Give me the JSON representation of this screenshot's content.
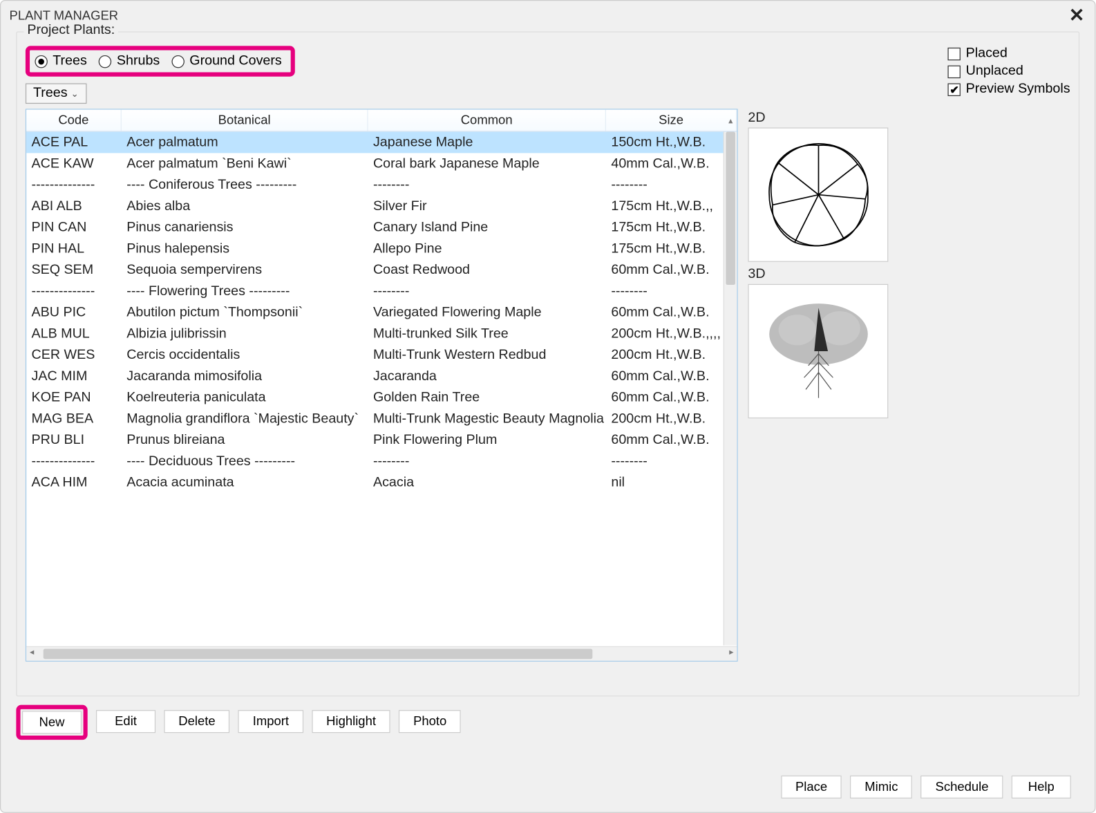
{
  "window": {
    "title": "PLANT MANAGER"
  },
  "group": {
    "label": "Project Plants:"
  },
  "radios": {
    "trees": "Trees",
    "shrubs": "Shrubs",
    "ground": "Ground Covers",
    "selected": "trees"
  },
  "checks": {
    "placed": {
      "label": "Placed",
      "checked": false
    },
    "unplaced": {
      "label": "Unplaced",
      "checked": false
    },
    "preview": {
      "label": "Preview Symbols",
      "checked": true
    }
  },
  "dropdown": {
    "value": "Trees"
  },
  "columns": {
    "code": "Code",
    "botanical": "Botanical",
    "common": "Common",
    "size": "Size"
  },
  "rows": [
    {
      "code": "ACE PAL",
      "botanical": "Acer palmatum",
      "common": "Japanese Maple",
      "size": "150cm Ht.,W.B.",
      "selected": true
    },
    {
      "code": "ACE KAW",
      "botanical": "Acer palmatum `Beni Kawi`",
      "common": "Coral bark Japanese Maple",
      "size": "40mm Cal.,W.B."
    },
    {
      "code": "--------------",
      "botanical": "---- Coniferous Trees ---------",
      "common": "--------",
      "size": "--------"
    },
    {
      "code": "ABI ALB",
      "botanical": "Abies alba",
      "common": "Silver Fir",
      "size": "175cm Ht.,W.B.,,"
    },
    {
      "code": "PIN CAN",
      "botanical": "Pinus canariensis",
      "common": "Canary Island Pine",
      "size": "175cm Ht.,W.B."
    },
    {
      "code": "PIN HAL",
      "botanical": "Pinus halepensis",
      "common": "Allepo Pine",
      "size": "175cm Ht.,W.B."
    },
    {
      "code": "SEQ SEM",
      "botanical": "Sequoia sempervirens",
      "common": "Coast Redwood",
      "size": "60mm Cal.,W.B."
    },
    {
      "code": "--------------",
      "botanical": "---- Flowering Trees ---------",
      "common": "--------",
      "size": "--------"
    },
    {
      "code": "ABU PIC",
      "botanical": "Abutilon pictum `Thompsonii`",
      "common": "Variegated Flowering Maple",
      "size": "60mm Cal.,W.B."
    },
    {
      "code": "ALB MUL",
      "botanical": "Albizia julibrissin",
      "common": "Multi-trunked Silk Tree",
      "size": "200cm Ht.,W.B.,,,,"
    },
    {
      "code": "CER WES",
      "botanical": "Cercis occidentalis",
      "common": "Multi-Trunk Western Redbud",
      "size": "200cm Ht.,W.B."
    },
    {
      "code": "JAC MIM",
      "botanical": "Jacaranda mimosifolia",
      "common": "Jacaranda",
      "size": "60mm Cal.,W.B."
    },
    {
      "code": "KOE PAN",
      "botanical": "Koelreuteria paniculata",
      "common": "Golden Rain Tree",
      "size": "60mm Cal.,W.B."
    },
    {
      "code": "MAG BEA",
      "botanical": "Magnolia grandiflora `Majestic Beauty`",
      "common": "Multi-Trunk Magestic Beauty Magnolia",
      "size": "200cm Ht.,W.B."
    },
    {
      "code": "PRU BLI",
      "botanical": "Prunus blireiana",
      "common": "Pink Flowering Plum",
      "size": "60mm Cal.,W.B."
    },
    {
      "code": "--------------",
      "botanical": "---- Deciduous Trees ---------",
      "common": "--------",
      "size": "--------"
    },
    {
      "code": "ACA HIM",
      "botanical": "Acacia acuminata",
      "common": "Acacia",
      "size": "nil"
    }
  ],
  "preview": {
    "label2d": "2D",
    "label3d": "3D"
  },
  "buttons": {
    "new": "New",
    "edit": "Edit",
    "delete": "Delete",
    "import": "Import",
    "highlight": "Highlight",
    "photo": "Photo",
    "place": "Place",
    "mimic": "Mimic",
    "schedule": "Schedule",
    "help": "Help"
  }
}
